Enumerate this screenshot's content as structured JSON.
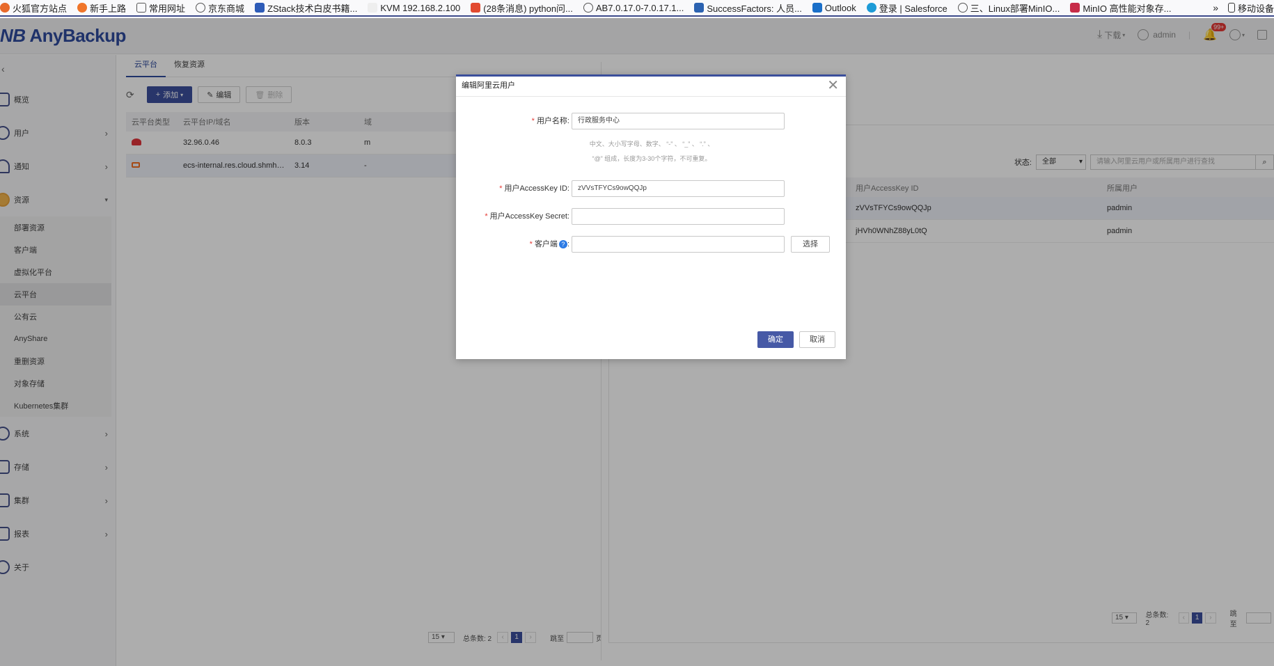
{
  "bookmarks": [
    "火狐官方站点",
    "新手上路",
    "常用网址",
    "京东商城",
    "ZStack技术白皮书籍...",
    "KVM 192.168.2.100",
    "(28条消息) python问...",
    "AB7.0.17.0-7.0.17.1...",
    "SuccessFactors: 人员...",
    "Outlook",
    "登录 | Salesforce",
    "三、Linux部署MinIO...",
    "MinIO 高性能对象存...",
    "移动设备"
  ],
  "header": {
    "logo": "AnyBackup",
    "download": "下载",
    "user": "admin",
    "badge": "99+"
  },
  "sidebar": {
    "menu_top": [
      {
        "label": "概览"
      },
      {
        "label": "用户"
      },
      {
        "label": "通知"
      },
      {
        "label": "资源"
      }
    ],
    "sub": [
      "部署资源",
      "客户端",
      "虚拟化平台",
      "云平台",
      "公有云",
      "AnyShare",
      "重删资源",
      "对象存储",
      "Kubernetes集群"
    ],
    "menu_bottom": [
      {
        "label": "系统"
      },
      {
        "label": "存储"
      },
      {
        "label": "集群"
      },
      {
        "label": "报表"
      },
      {
        "label": "关于"
      }
    ]
  },
  "main": {
    "tabs": [
      "云平台",
      "恢复资源"
    ],
    "toolbar": {
      "add": "添加",
      "edit": "编辑",
      "delete": "删除"
    },
    "columns": [
      "云平台类型",
      "云平台IP/域名",
      "版本",
      "域"
    ],
    "rows": [
      {
        "ip": "32.96.0.46",
        "ver": "8.0.3",
        "domain": "m"
      },
      {
        "ip": "ecs-internal.res.cloud.shmh…",
        "ver": "3.14",
        "domain": "-"
      }
    ],
    "pager": {
      "size": "15",
      "total": "总条数: 2",
      "page": "1",
      "jump": "跳至",
      "suffix": "页"
    }
  },
  "right": {
    "status_label": "状态:",
    "status_value": "全部",
    "search_placeholder": "请输入阿里云用户或所属用户进行查找",
    "columns": [
      "用户AccessKey ID",
      "所属用户"
    ],
    "rows": [
      {
        "key": "zVVsTFYCs9owQQJp",
        "owner": "padmin"
      },
      {
        "key": "jHVh0WNhZ88yL0tQ",
        "owner": "padmin"
      }
    ],
    "pager": {
      "size": "15",
      "total": "总条数: 2",
      "page": "1",
      "jump": "跳至"
    }
  },
  "dialog": {
    "title": "编辑阿里云用户",
    "name_label": "用户名称:",
    "name_value": "行政服务中心",
    "hint1": "中文、大小写字母、数字、 “-” 、 “_” 、 “.” 、",
    "hint2": "“@” 组成，长度为3-30个字符，不可重复。",
    "akid_label": "用户AccessKey ID:",
    "akid_value": "zVVsTFYCs9owQQJp",
    "secret_label": "用户AccessKey Secret:",
    "secret_value": "",
    "client_label": "客户端",
    "client_value": "",
    "pick": "选择",
    "ok": "确定",
    "cancel": "取消"
  }
}
